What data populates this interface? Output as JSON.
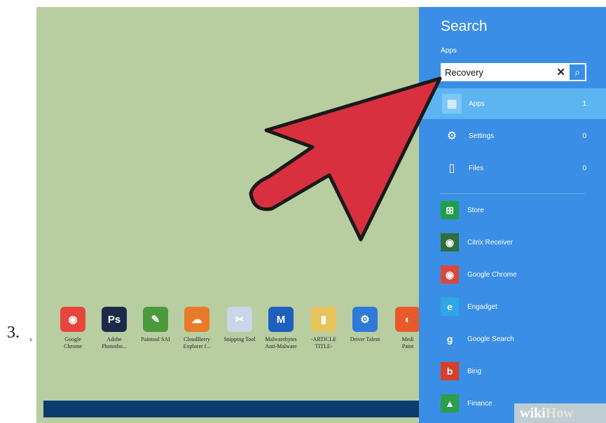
{
  "step_number": "3.",
  "desktop": {
    "icons": [
      {
        "label": "s",
        "icon": "partial-icon",
        "color": "#b8cea0",
        "glyph": ""
      },
      {
        "label": "Google\nChrome",
        "icon": "chrome-icon",
        "color": "#e8453c",
        "glyph": "◉"
      },
      {
        "label": "Adobe\nPhotosho...",
        "icon": "photoshop-icon",
        "color": "#1c2a4a",
        "glyph": "Ps"
      },
      {
        "label": "Paintool SAI",
        "icon": "paintool-sai-icon",
        "color": "#4c9a3c",
        "glyph": "✎"
      },
      {
        "label": "CloudBerry\nExplorer f...",
        "icon": "cloudberry-icon",
        "color": "#e87a2a",
        "glyph": "☁"
      },
      {
        "label": "Snipping Tool",
        "icon": "snipping-tool-icon",
        "color": "#c8d6e8",
        "glyph": "✂"
      },
      {
        "label": "Malwarebytes\nAnti-Malware",
        "icon": "malwarebytes-icon",
        "color": "#1f5fbf",
        "glyph": "M"
      },
      {
        "label": "-ARTICLE\nTITLE-",
        "icon": "folder-icon",
        "color": "#e8c25a",
        "glyph": "▮"
      },
      {
        "label": "Driver Talent",
        "icon": "driver-talent-icon",
        "color": "#2f7ad8",
        "glyph": "⚙"
      },
      {
        "label": "Medi\nPaint",
        "icon": "medibang-icon",
        "color": "#e85a2a",
        "glyph": "◐"
      }
    ]
  },
  "charm": {
    "title": "Search",
    "scope": "Apps",
    "search": {
      "value": "Recovery",
      "clear_glyph": "✕",
      "go_glyph": "⌕"
    },
    "categories": [
      {
        "label": "Apps",
        "count": "1",
        "icon": "apps-icon",
        "glyph": "▦"
      },
      {
        "label": "Settings",
        "count": "0",
        "icon": "settings-gear-icon",
        "glyph": "⚙"
      },
      {
        "label": "Files",
        "count": "0",
        "icon": "file-icon",
        "glyph": "▯"
      }
    ],
    "apps": [
      {
        "label": "Store",
        "icon": "store-icon",
        "color": "#1f9e4a",
        "glyph": "⊞"
      },
      {
        "label": "Citrix Receiver",
        "icon": "citrix-receiver-icon",
        "color": "#2f6e3c",
        "glyph": "◉"
      },
      {
        "label": "Google Chrome",
        "icon": "chrome-icon",
        "color": "#d9483b",
        "glyph": "◉"
      },
      {
        "label": "Engadget",
        "icon": "engadget-icon",
        "color": "#2fa6e6",
        "glyph": "e"
      },
      {
        "label": "Google Search",
        "icon": "google-search-icon",
        "color": "#3a8ee6",
        "glyph": "g"
      },
      {
        "label": "Bing",
        "icon": "bing-icon",
        "color": "#d6402a",
        "glyph": "b"
      },
      {
        "label": "Finance",
        "icon": "finance-icon",
        "color": "#2f9e4a",
        "glyph": "▲"
      }
    ]
  },
  "watermark": {
    "part1": "wiki",
    "part2": "How"
  },
  "colors": {
    "charm_bg": "#3a8ee6",
    "arrow": "#d9303f",
    "desktop": "#b8cea0",
    "taskbar": "#0c3b6e"
  }
}
